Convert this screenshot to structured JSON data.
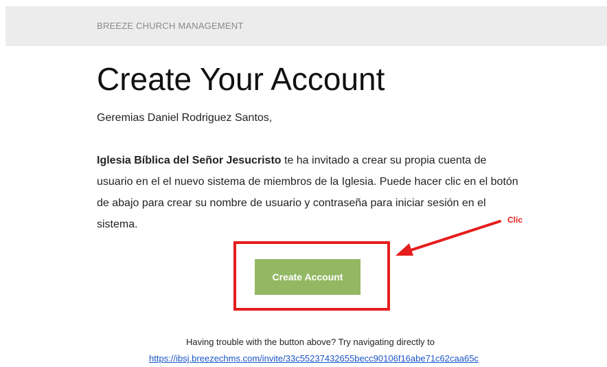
{
  "header": {
    "brand": "BREEZE CHURCH MANAGEMENT"
  },
  "main": {
    "title": "Create Your Account",
    "greeting": "Geremias Daniel Rodriguez Santos,",
    "church_name": "Iglesia Bíblica del Señor Jesucristo",
    "body_text": " te ha invitado a crear su propia cuenta de usuario en el el nuevo sistema de miembros de la Iglesia. Puede hacer clic en el botón de abajo para crear su nombre de usuario y contraseña para iniciar sesión en el sistema.",
    "button_label": "Create Account"
  },
  "annotation": {
    "label": "Clic",
    "color": "#e51d1d"
  },
  "footer": {
    "help_text": "Having trouble with the button above? Try navigating directly to",
    "link_text": "https://ibsj.breezechms.com/invite/33c55237432655becc90106f16abe71c62caa65c"
  },
  "colors": {
    "button_bg": "#93b863",
    "header_bg": "#ececec",
    "link": "#1a55c9"
  }
}
